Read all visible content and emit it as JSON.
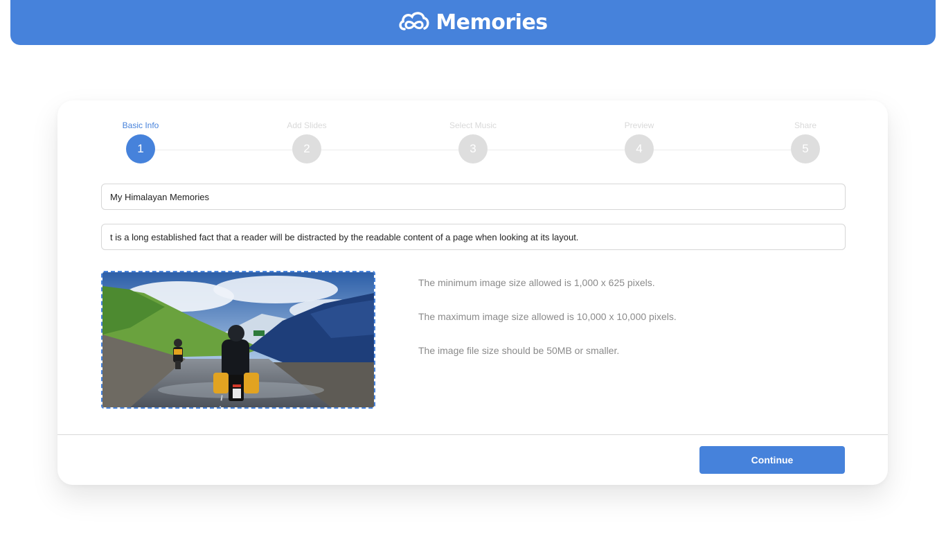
{
  "header": {
    "brand_name": "Memories",
    "logo_icon": "cloud-infinity-icon",
    "color": "#4682db"
  },
  "stepper": {
    "steps": [
      {
        "label": "Basic Info",
        "number": "1",
        "active": true
      },
      {
        "label": "Add Slides",
        "number": "2",
        "active": false
      },
      {
        "label": "Select Music",
        "number": "3",
        "active": false
      },
      {
        "label": "Preview",
        "number": "4",
        "active": false
      },
      {
        "label": "Share",
        "number": "5",
        "active": false
      }
    ]
  },
  "form": {
    "title_value": "My Himalayan Memories",
    "description_value": "t is a long established fact that a reader will be distracted by the readable content of a page when looking at its layout."
  },
  "upload": {
    "image_icon": "motorcycle-mountain-photo",
    "rules": [
      "The minimum image size allowed is 1,000 x 625 pixels.",
      "The maximum image size allowed is 10,000 x 10,000 pixels.",
      "The image file size should be 50MB or smaller."
    ]
  },
  "footer": {
    "continue_label": "Continue"
  }
}
